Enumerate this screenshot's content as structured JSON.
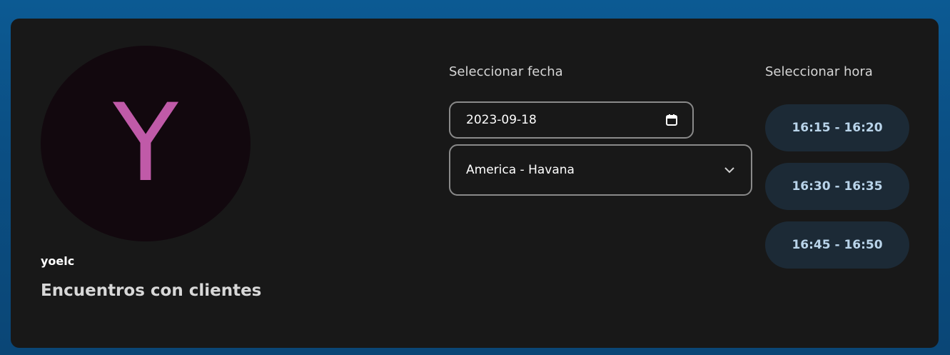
{
  "profile": {
    "avatar_letter": "Y",
    "username": "yoelc",
    "event_title": "Encuentros con clientes"
  },
  "date_picker": {
    "label": "Seleccionar fecha",
    "value": "2023-09-18"
  },
  "timezone": {
    "value": "America - Havana"
  },
  "time_picker": {
    "label": "Seleccionar hora",
    "slots": [
      "16:15 - 16:20",
      "16:30 - 16:35",
      "16:45 - 16:50"
    ]
  },
  "colors": {
    "card_background": "#181818",
    "avatar_letter": "#c05aa8",
    "slot_background": "#1c2a36",
    "slot_text": "#b9d4ea"
  },
  "icons": {
    "date": "calendar-icon",
    "timezone": "chevron-down-icon"
  }
}
